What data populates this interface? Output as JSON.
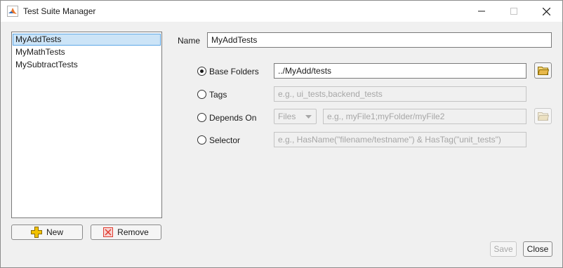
{
  "window": {
    "title": "Test Suite Manager",
    "controls": {
      "minimize": "minimize",
      "maximize": "maximize",
      "close": "close"
    }
  },
  "suites": {
    "items": [
      "MyAddTests",
      "MyMathTests",
      "MySubtractTests"
    ],
    "selected": "MyAddTests"
  },
  "left_buttons": {
    "new_label": "New",
    "remove_label": "Remove"
  },
  "form": {
    "name_label": "Name",
    "name_value": "MyAddTests",
    "selected_option": "Base Folders",
    "base_folders": {
      "label": "Base Folders",
      "value": "../MyAdd/tests"
    },
    "tags": {
      "label": "Tags",
      "placeholder": "e.g., ui_tests,backend_tests"
    },
    "depends_on": {
      "label": "Depends On",
      "type_value": "Files",
      "placeholder": "e.g., myFile1;myFolder/myFile2"
    },
    "selector": {
      "label": "Selector",
      "placeholder": "e.g., HasName(\"filename/testname\") & HasTag(\"unit_tests\")"
    }
  },
  "footer": {
    "save_label": "Save",
    "close_label": "Close"
  },
  "colors": {
    "selection": "#cce4f7",
    "selection_border": "#5ba6e6",
    "folder": "#e8b84a",
    "add_icon": "#f2c200",
    "remove_icon": "#e03c31"
  }
}
